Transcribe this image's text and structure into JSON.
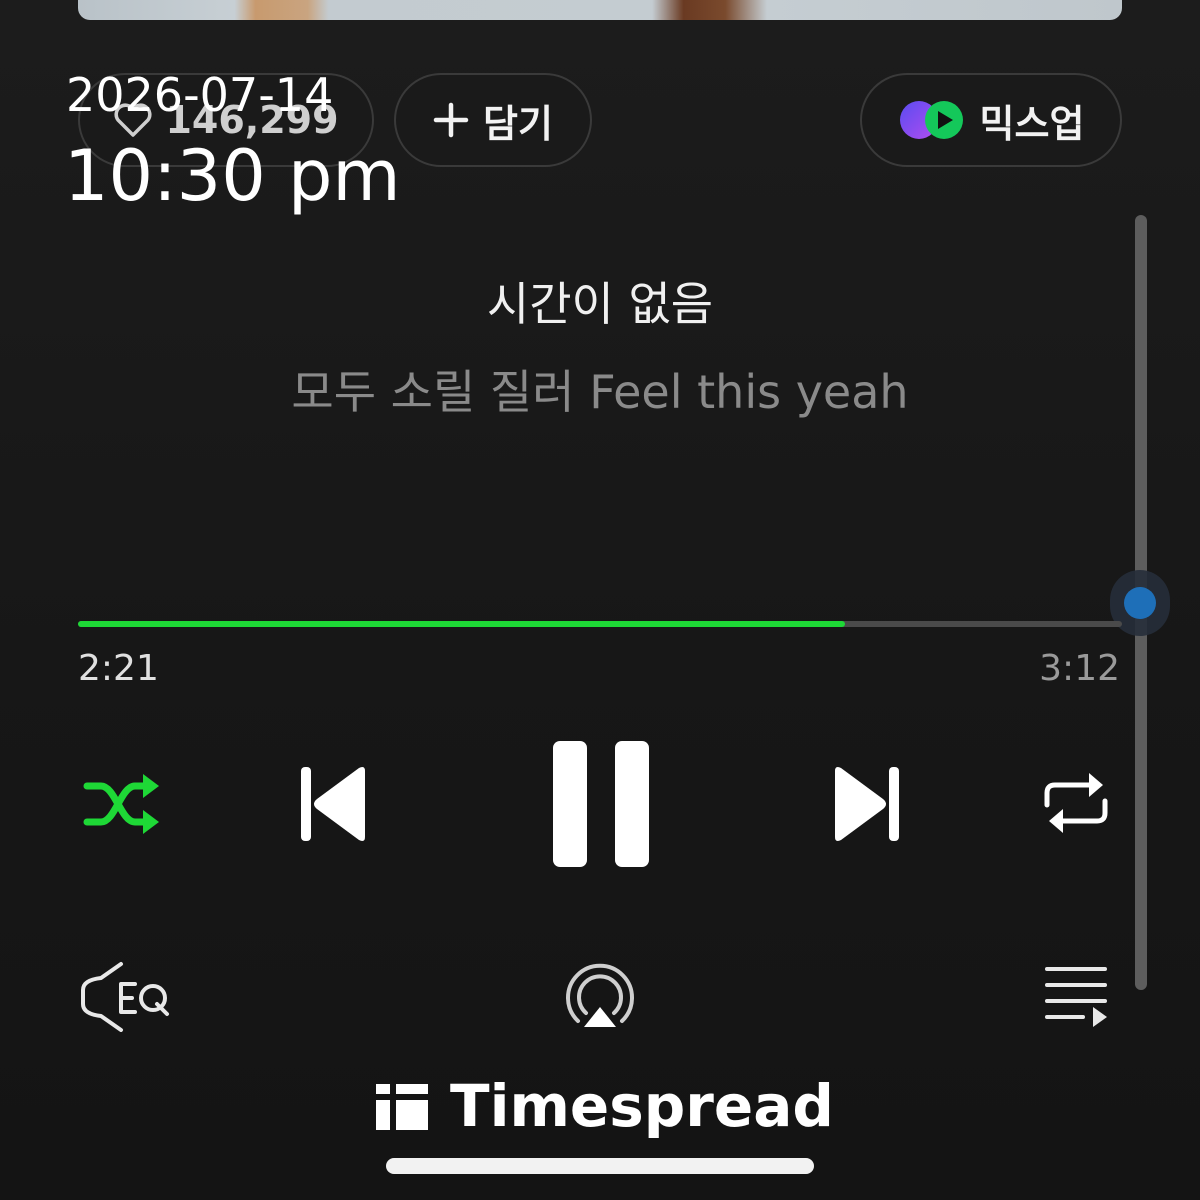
{
  "header": {
    "like_count": "146,299",
    "add_label": "담기",
    "mixup_label": "믹스업"
  },
  "overlay": {
    "date": "2026-07-14",
    "time": "10:30 pm"
  },
  "lyrics": {
    "current": "시간이 없음",
    "next": "모두 소릴 질러 Feel this yeah"
  },
  "playback": {
    "elapsed": "2:21",
    "total": "3:12",
    "progress_fraction": 0.735,
    "state": "playing"
  },
  "controls": {
    "shuffle_icon": "shuffle-icon",
    "prev_icon": "skip-previous-icon",
    "pause_icon": "pause-icon",
    "next_icon": "skip-next-icon",
    "repeat_icon": "repeat-icon",
    "eq_icon": "equalizer-icon",
    "airplay_icon": "airplay-icon",
    "playlist_icon": "playlist-icon"
  },
  "colors": {
    "accent": "#1ed836",
    "background": "#171717",
    "lyric_dim": "#8a8a8a",
    "scroll_dot": "#1e6fb8"
  },
  "watermark": {
    "text": "Timespread"
  }
}
